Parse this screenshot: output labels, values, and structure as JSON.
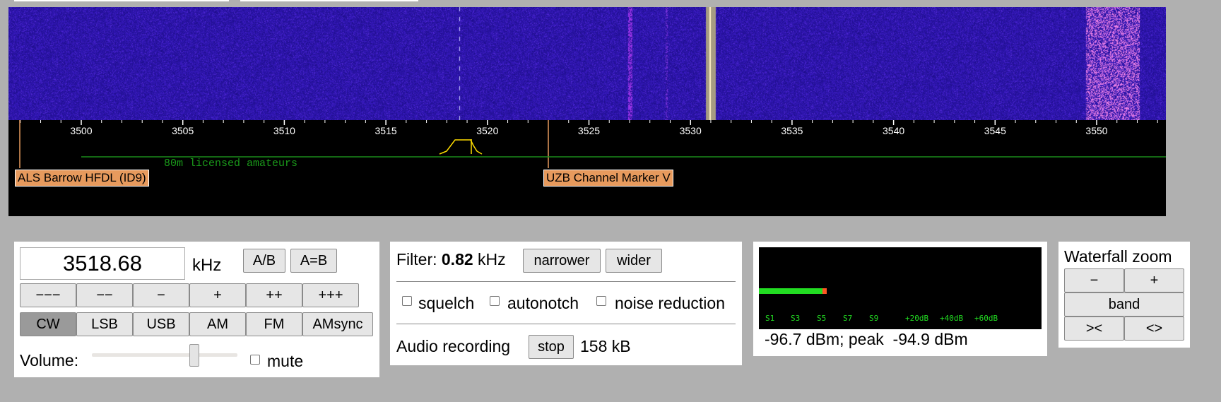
{
  "waterfall_scale": {
    "ticks": [
      "3500",
      "3505",
      "3510",
      "3515",
      "3520",
      "3525",
      "3530",
      "3535",
      "3540",
      "3545",
      "3550"
    ],
    "band_label": "80m licensed amateurs",
    "markers": [
      "ALS Barrow HFDL (ID9)",
      "UZB Channel Marker V"
    ],
    "colors": {
      "tick_text": "#ffffff",
      "band_line": "#1a8a1a",
      "passband": "#ffdd00",
      "marker": "#e79a5d"
    }
  },
  "tuning": {
    "frequency": "3518.68",
    "unit": "kHz",
    "ab_label": "A/B",
    "aeqb_label": "A=B",
    "steps": [
      "−−−",
      "−−",
      "−",
      "+",
      "++",
      "+++"
    ],
    "modes": [
      "CW",
      "LSB",
      "USB",
      "AM",
      "FM",
      "AMsync"
    ],
    "active_mode": "CW",
    "volume_label": "Volume:",
    "volume_level": 0.72,
    "mute_label": "mute",
    "mute_checked": false
  },
  "filter": {
    "label": "Filter:",
    "width": "0.82",
    "unit": "kHz",
    "narrower_label": "narrower",
    "wider_label": "wider",
    "squelch_label": "squelch",
    "autonotch_label": "autonotch",
    "noise_reduction_label": "noise reduction",
    "recording_label": "Audio recording",
    "stop_label": "stop",
    "recording_size": "158 kB"
  },
  "smeter": {
    "scale_labels": [
      "S1",
      "S3",
      "S5",
      "S7",
      "S9",
      "+20dB",
      "+40dB",
      "+60dB"
    ],
    "level_fraction": 0.24,
    "readout": "-96.7 dBm; peak  -94.9 dBm",
    "colors": {
      "bar": "#22dd22",
      "peak": "#ff5522",
      "scale": "#22dd22"
    }
  },
  "zoom": {
    "title": "Waterfall zoom",
    "minus_label": "−",
    "plus_label": "+",
    "band_label": "band",
    "narrow_label": "><",
    "widen_label": "<>"
  }
}
